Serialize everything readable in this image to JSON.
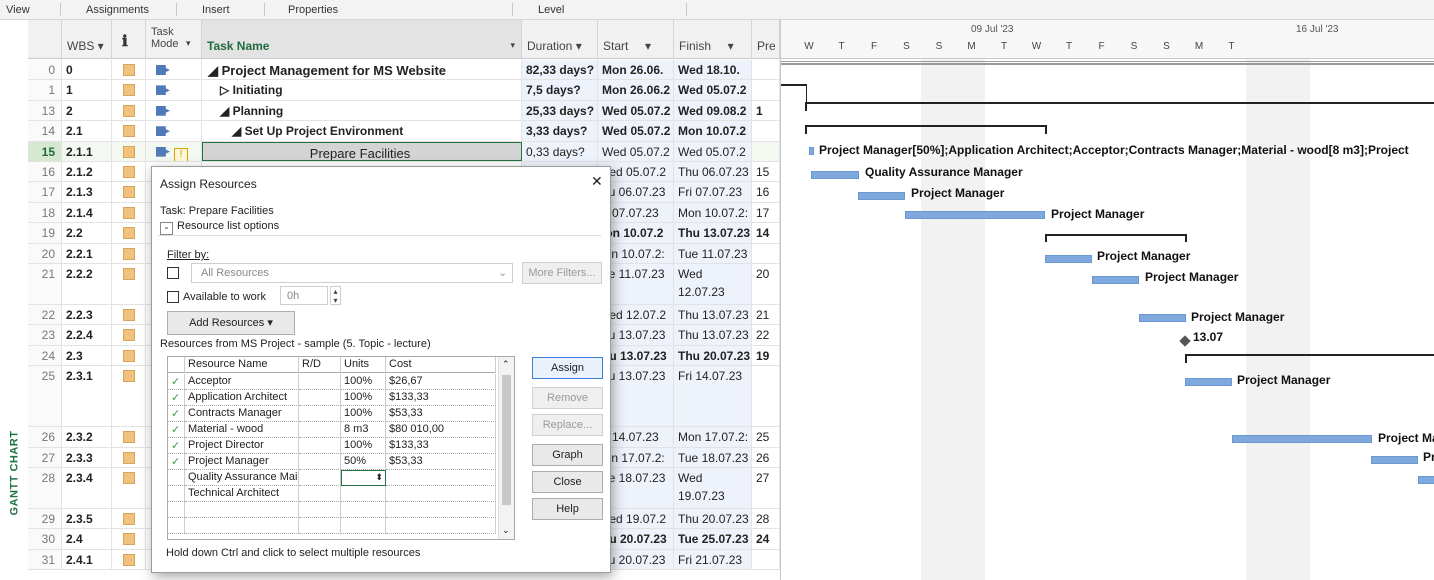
{
  "ribbon": {
    "tabs": [
      "View",
      "Assignments",
      "Insert",
      "Properties",
      "Level"
    ]
  },
  "sidebar": {
    "label": "GANTT CHART"
  },
  "columns": {
    "wbs": "WBS",
    "info": "ℹ",
    "mode": "Task Mode",
    "name": "Task Name",
    "duration": "Duration",
    "start": "Start",
    "finish": "Finish",
    "pred": "Pre"
  },
  "rows": [
    {
      "id": "0",
      "wbs": "0",
      "name": "◢ Project Management for MS Website",
      "duration": "82,33 days?",
      "start": "Mon 26.06.",
      "finish": "Wed 18.10.",
      "pred": "",
      "bold": true,
      "indent": 0
    },
    {
      "id": "1",
      "wbs": "1",
      "name": "▷ Initiating",
      "duration": "7,5 days?",
      "start": "Mon 26.06.2",
      "finish": "Wed 05.07.2",
      "pred": "",
      "bold": true,
      "indent": 1
    },
    {
      "id": "13",
      "wbs": "2",
      "name": "◢ Planning",
      "duration": "25,33 days?",
      "start": "Wed 05.07.2",
      "finish": "Wed 09.08.2",
      "pred": "1",
      "bold": true,
      "indent": 1
    },
    {
      "id": "14",
      "wbs": "2.1",
      "name": "◢ Set Up Project Environment",
      "duration": "3,33 days?",
      "start": "Wed 05.07.2",
      "finish": "Mon 10.07.2",
      "pred": "",
      "bold": true,
      "indent": 2
    },
    {
      "id": "15",
      "wbs": "2.1.1",
      "name": "Prepare Facilities",
      "duration": "0,33 days?",
      "start": "Wed 05.07.2",
      "finish": "Wed 05.07.2",
      "pred": "",
      "bold": false,
      "indent": 3
    },
    {
      "id": "16",
      "wbs": "2.1.2",
      "name": "",
      "duration": "",
      "start": "Ved 05.07.2",
      "finish": "Thu 06.07.23",
      "pred": "15",
      "bold": false,
      "indent": 3
    },
    {
      "id": "17",
      "wbs": "2.1.3",
      "name": "",
      "duration": "",
      "start": "hu 06.07.23",
      "finish": "Fri 07.07.23",
      "pred": "16",
      "bold": false,
      "indent": 3
    },
    {
      "id": "18",
      "wbs": "2.1.4",
      "name": "",
      "duration": "",
      "start": "ri 07.07.23",
      "finish": "Mon 10.07.2:",
      "pred": "17",
      "bold": false,
      "indent": 3
    },
    {
      "id": "19",
      "wbs": "2.2",
      "name": "",
      "duration": "",
      "start": "lon 10.07.2",
      "finish": "Thu 13.07.23",
      "pred": "14",
      "bold": true,
      "indent": 2
    },
    {
      "id": "20",
      "wbs": "2.2.1",
      "name": "",
      "duration": "",
      "start": "lon 10.07.2:",
      "finish": "Tue 11.07.23",
      "pred": "",
      "bold": false,
      "indent": 3
    },
    {
      "id": "21",
      "wbs": "2.2.2",
      "name": "",
      "duration": "",
      "start": "ue 11.07.23",
      "finish": "Wed",
      "finish2": "12.07.23",
      "pred": "20",
      "bold": false,
      "indent": 3,
      "tall": true
    },
    {
      "id": "22",
      "wbs": "2.2.3",
      "name": "",
      "duration": "",
      "start": "Ved 12.07.2",
      "finish": "Thu 13.07.23",
      "pred": "21",
      "bold": false,
      "indent": 3
    },
    {
      "id": "23",
      "wbs": "2.2.4",
      "name": "",
      "duration": "",
      "start": "hu 13.07.23",
      "finish": "Thu 13.07.23",
      "pred": "22",
      "bold": false,
      "indent": 3
    },
    {
      "id": "24",
      "wbs": "2.3",
      "name": "",
      "duration": "",
      "start": "hu 13.07.23",
      "finish": "Thu 20.07.23",
      "pred": "19",
      "bold": true,
      "indent": 2
    },
    {
      "id": "25",
      "wbs": "2.3.1",
      "name": "",
      "duration": "",
      "start": "hu 13.07.23",
      "finish": "Fri 14.07.23",
      "pred": "",
      "bold": false,
      "indent": 3,
      "xtall": true
    },
    {
      "id": "26",
      "wbs": "2.3.2",
      "name": "",
      "duration": "",
      "start": "ri 14.07.23",
      "finish": "Mon 17.07.2:",
      "pred": "25",
      "bold": false,
      "indent": 3
    },
    {
      "id": "27",
      "wbs": "2.3.3",
      "name": "",
      "duration": "",
      "start": "lon 17.07.2:",
      "finish": "Tue 18.07.23",
      "pred": "26",
      "bold": false,
      "indent": 3
    },
    {
      "id": "28",
      "wbs": "2.3.4",
      "name": "",
      "duration": "",
      "start": "ue 18.07.23",
      "finish": "Wed",
      "finish2": "19.07.23",
      "pred": "27",
      "bold": false,
      "indent": 3,
      "tall": true
    },
    {
      "id": "29",
      "wbs": "2.3.5",
      "name": "",
      "duration": "",
      "start": "Ved 19.07.2",
      "finish": "Thu 20.07.23",
      "pred": "28",
      "bold": false,
      "indent": 3
    },
    {
      "id": "30",
      "wbs": "2.4",
      "name": "",
      "duration": "",
      "start": "hu 20.07.23",
      "finish": "Tue 25.07.23",
      "pred": "24",
      "bold": true,
      "indent": 2
    },
    {
      "id": "31",
      "wbs": "2.4.1",
      "name": "",
      "duration": "",
      "start": "hu 20.07.23",
      "finish": "Fri 21.07.23",
      "pred": "",
      "bold": false,
      "indent": 3
    }
  ],
  "gantt": {
    "weeks": [
      "09 Jul '23",
      "16 Jul '23"
    ],
    "days": [
      "W",
      "T",
      "F",
      "S",
      "S",
      "M",
      "T",
      "W",
      "T",
      "F",
      "S",
      "S",
      "M",
      "T"
    ],
    "labels": {
      "r15": "Project Manager[50%];Application Architect;Acceptor;Contracts Manager;Material - wood[8 m3];Project",
      "r16": "Quality Assurance Manager",
      "r17": "Project Manager",
      "r18": "Project Manager",
      "r20": "Project Manager",
      "r21": "Project Manager",
      "r22": "Project Manager",
      "r23": "13.07",
      "r25": "Project Manager",
      "r26": "Project Ma",
      "r27": "Pr"
    }
  },
  "dialog": {
    "title": "Assign Resources",
    "close": "✕",
    "task": "Task: Prepare Facilities",
    "options_toggle": "-",
    "options_label": "Resource list options",
    "filter_label": "Filter by:",
    "filter_value": "All Resources",
    "more_filters": "More Filters...",
    "available_label": "Available to work",
    "available_value": "0h",
    "add_resources": "Add Resources",
    "resources_from": "Resources from MS Project - sample (5. Topic - lecture)",
    "grid_headers": {
      "name": "Resource Name",
      "rd": "R/D",
      "units": "Units",
      "cost": "Cost"
    },
    "resources": [
      {
        "check": "✓",
        "name": "Acceptor",
        "rd": "",
        "units": "100%",
        "cost": "$26,67"
      },
      {
        "check": "✓",
        "name": "Application Architect",
        "rd": "",
        "units": "100%",
        "cost": "$133,33"
      },
      {
        "check": "✓",
        "name": "Contracts Manager",
        "rd": "",
        "units": "100%",
        "cost": "$53,33"
      },
      {
        "check": "✓",
        "name": "Material - wood",
        "rd": "",
        "units": "8 m3",
        "cost": "$80 010,00"
      },
      {
        "check": "✓",
        "name": "Project Director",
        "rd": "",
        "units": "100%",
        "cost": "$133,33"
      },
      {
        "check": "✓",
        "name": "Project Manager",
        "rd": "",
        "units": "50%",
        "cost": "$53,33"
      },
      {
        "check": "",
        "name": "Quality Assurance Mai",
        "rd": "",
        "units": "",
        "cost": ""
      },
      {
        "check": "",
        "name": "Technical Architect",
        "rd": "",
        "units": "",
        "cost": ""
      }
    ],
    "buttons": {
      "assign": "Assign",
      "remove": "Remove",
      "replace": "Replace...",
      "graph": "Graph",
      "close": "Close",
      "help": "Help"
    },
    "hint": "Hold down Ctrl and click to select multiple resources"
  }
}
